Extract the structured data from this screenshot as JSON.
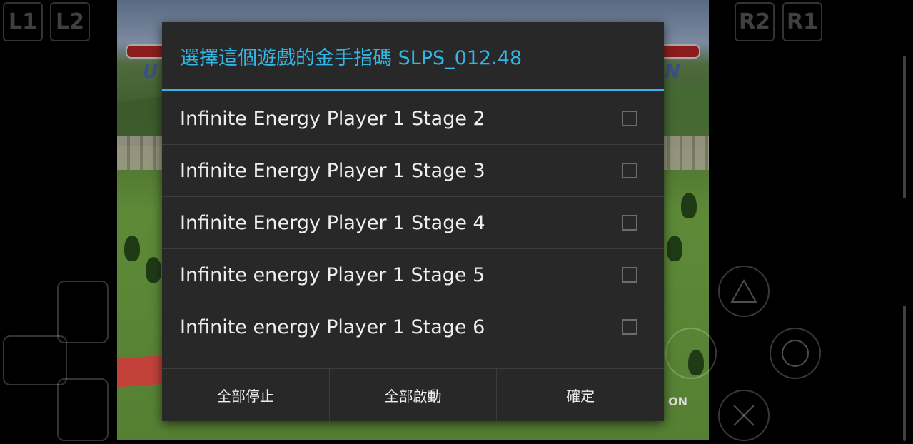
{
  "dialog": {
    "title": "選擇這個遊戲的金手指碼 SLPS_012.48",
    "items": [
      {
        "label": "Infinite Energy Player 1 Stage 2",
        "checked": false
      },
      {
        "label": "Infinite Energy Player 1 Stage 3",
        "checked": false
      },
      {
        "label": "Infinite Energy Player 1 Stage 4",
        "checked": false
      },
      {
        "label": "Infinite energy Player 1 Stage 5",
        "checked": false
      },
      {
        "label": "Infinite energy Player 1 Stage 6",
        "checked": false
      }
    ],
    "buttons": {
      "stop_all": "全部停止",
      "start_all": "全部啟動",
      "confirm": "確定"
    }
  },
  "controller": {
    "l1": "L1",
    "l2": "L2",
    "r2": "R2",
    "r1": "R1"
  },
  "colors": {
    "accent": "#33b5e5",
    "dialog_bg": "#282828"
  }
}
